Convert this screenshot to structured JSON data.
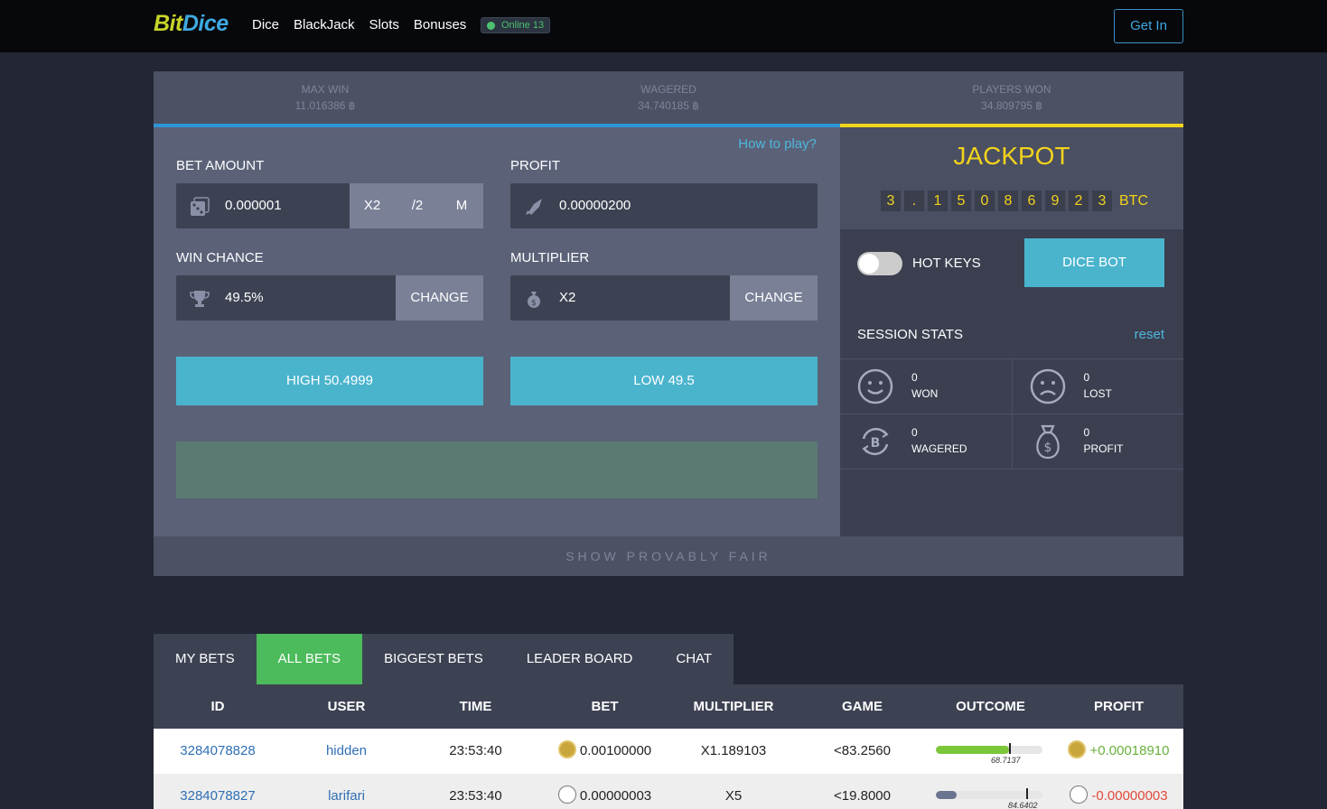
{
  "brand": {
    "part1": "Bit",
    "part2": "Dice"
  },
  "nav": {
    "items": [
      "Dice",
      "BlackJack",
      "Slots",
      "Bonuses"
    ],
    "online": "Online 13",
    "get_in": "Get In"
  },
  "stats": [
    {
      "label": "MAX WIN",
      "value": "11.016386 ฿"
    },
    {
      "label": "WAGERED",
      "value": "34.740185 ฿"
    },
    {
      "label": "PLAYERS WON",
      "value": "34.809795 ฿"
    }
  ],
  "game": {
    "how_to_play": "How to play?",
    "bet_amount": {
      "label": "BET AMOUNT",
      "value": "0.000001",
      "x2": "X2",
      "half": "/2",
      "max": "M"
    },
    "profit": {
      "label": "PROFIT",
      "value": "0.00000200"
    },
    "win_chance": {
      "label": "WIN CHANCE",
      "value": "49.5%",
      "change": "CHANGE"
    },
    "multiplier": {
      "label": "MULTIPLIER",
      "value": "X2",
      "change": "CHANGE"
    },
    "high_button": "HIGH 50.4999",
    "low_button": "LOW 49.5"
  },
  "jackpot": {
    "title": "JACKPOT",
    "digits": [
      "3",
      ".",
      "1",
      "5",
      "0",
      "8",
      "6",
      "9",
      "2",
      "3"
    ],
    "currency": "BTC"
  },
  "controls": {
    "hot_keys": "HOT KEYS",
    "dice_bot": "DICE BOT"
  },
  "session": {
    "title": "SESSION STATS",
    "reset": "reset",
    "won": {
      "value": "0",
      "label": "WON"
    },
    "lost": {
      "value": "0",
      "label": "LOST"
    },
    "wagered": {
      "value": "0",
      "label": "WAGERED"
    },
    "profit": {
      "value": "0",
      "label": "PROFIT"
    }
  },
  "provably_fair": "SHOW PROVABLY FAIR",
  "tabs": [
    "MY BETS",
    "ALL BETS",
    "BIGGEST BETS",
    "LEADER BOARD",
    "CHAT"
  ],
  "table": {
    "headers": [
      "ID",
      "USER",
      "TIME",
      "BET",
      "MULTIPLIER",
      "GAME",
      "OUTCOME",
      "PROFIT"
    ],
    "rows": [
      {
        "id": "3284078828",
        "user": "hidden",
        "time": "23:53:40",
        "bet": "0.00100000",
        "multiplier": "X1.189103",
        "game": "<83.2560",
        "outcome": "68.7137",
        "outcome_fill": 0.687,
        "profit": "+0.00018910"
      },
      {
        "id": "3284078827",
        "user": "larifari",
        "time": "23:53:40",
        "bet": "0.00000003",
        "multiplier": "X5",
        "game": "<19.8000",
        "outcome": "84.6402",
        "outcome_fill": 0.198,
        "profit": "-0.00000003"
      }
    ]
  },
  "colors": {
    "accent": "#4ab4cd",
    "jackpot": "#f2d31c",
    "active_tab": "#4cbb5c",
    "win_bar": "#7cc63a",
    "loss_bar": "#6a7390"
  }
}
